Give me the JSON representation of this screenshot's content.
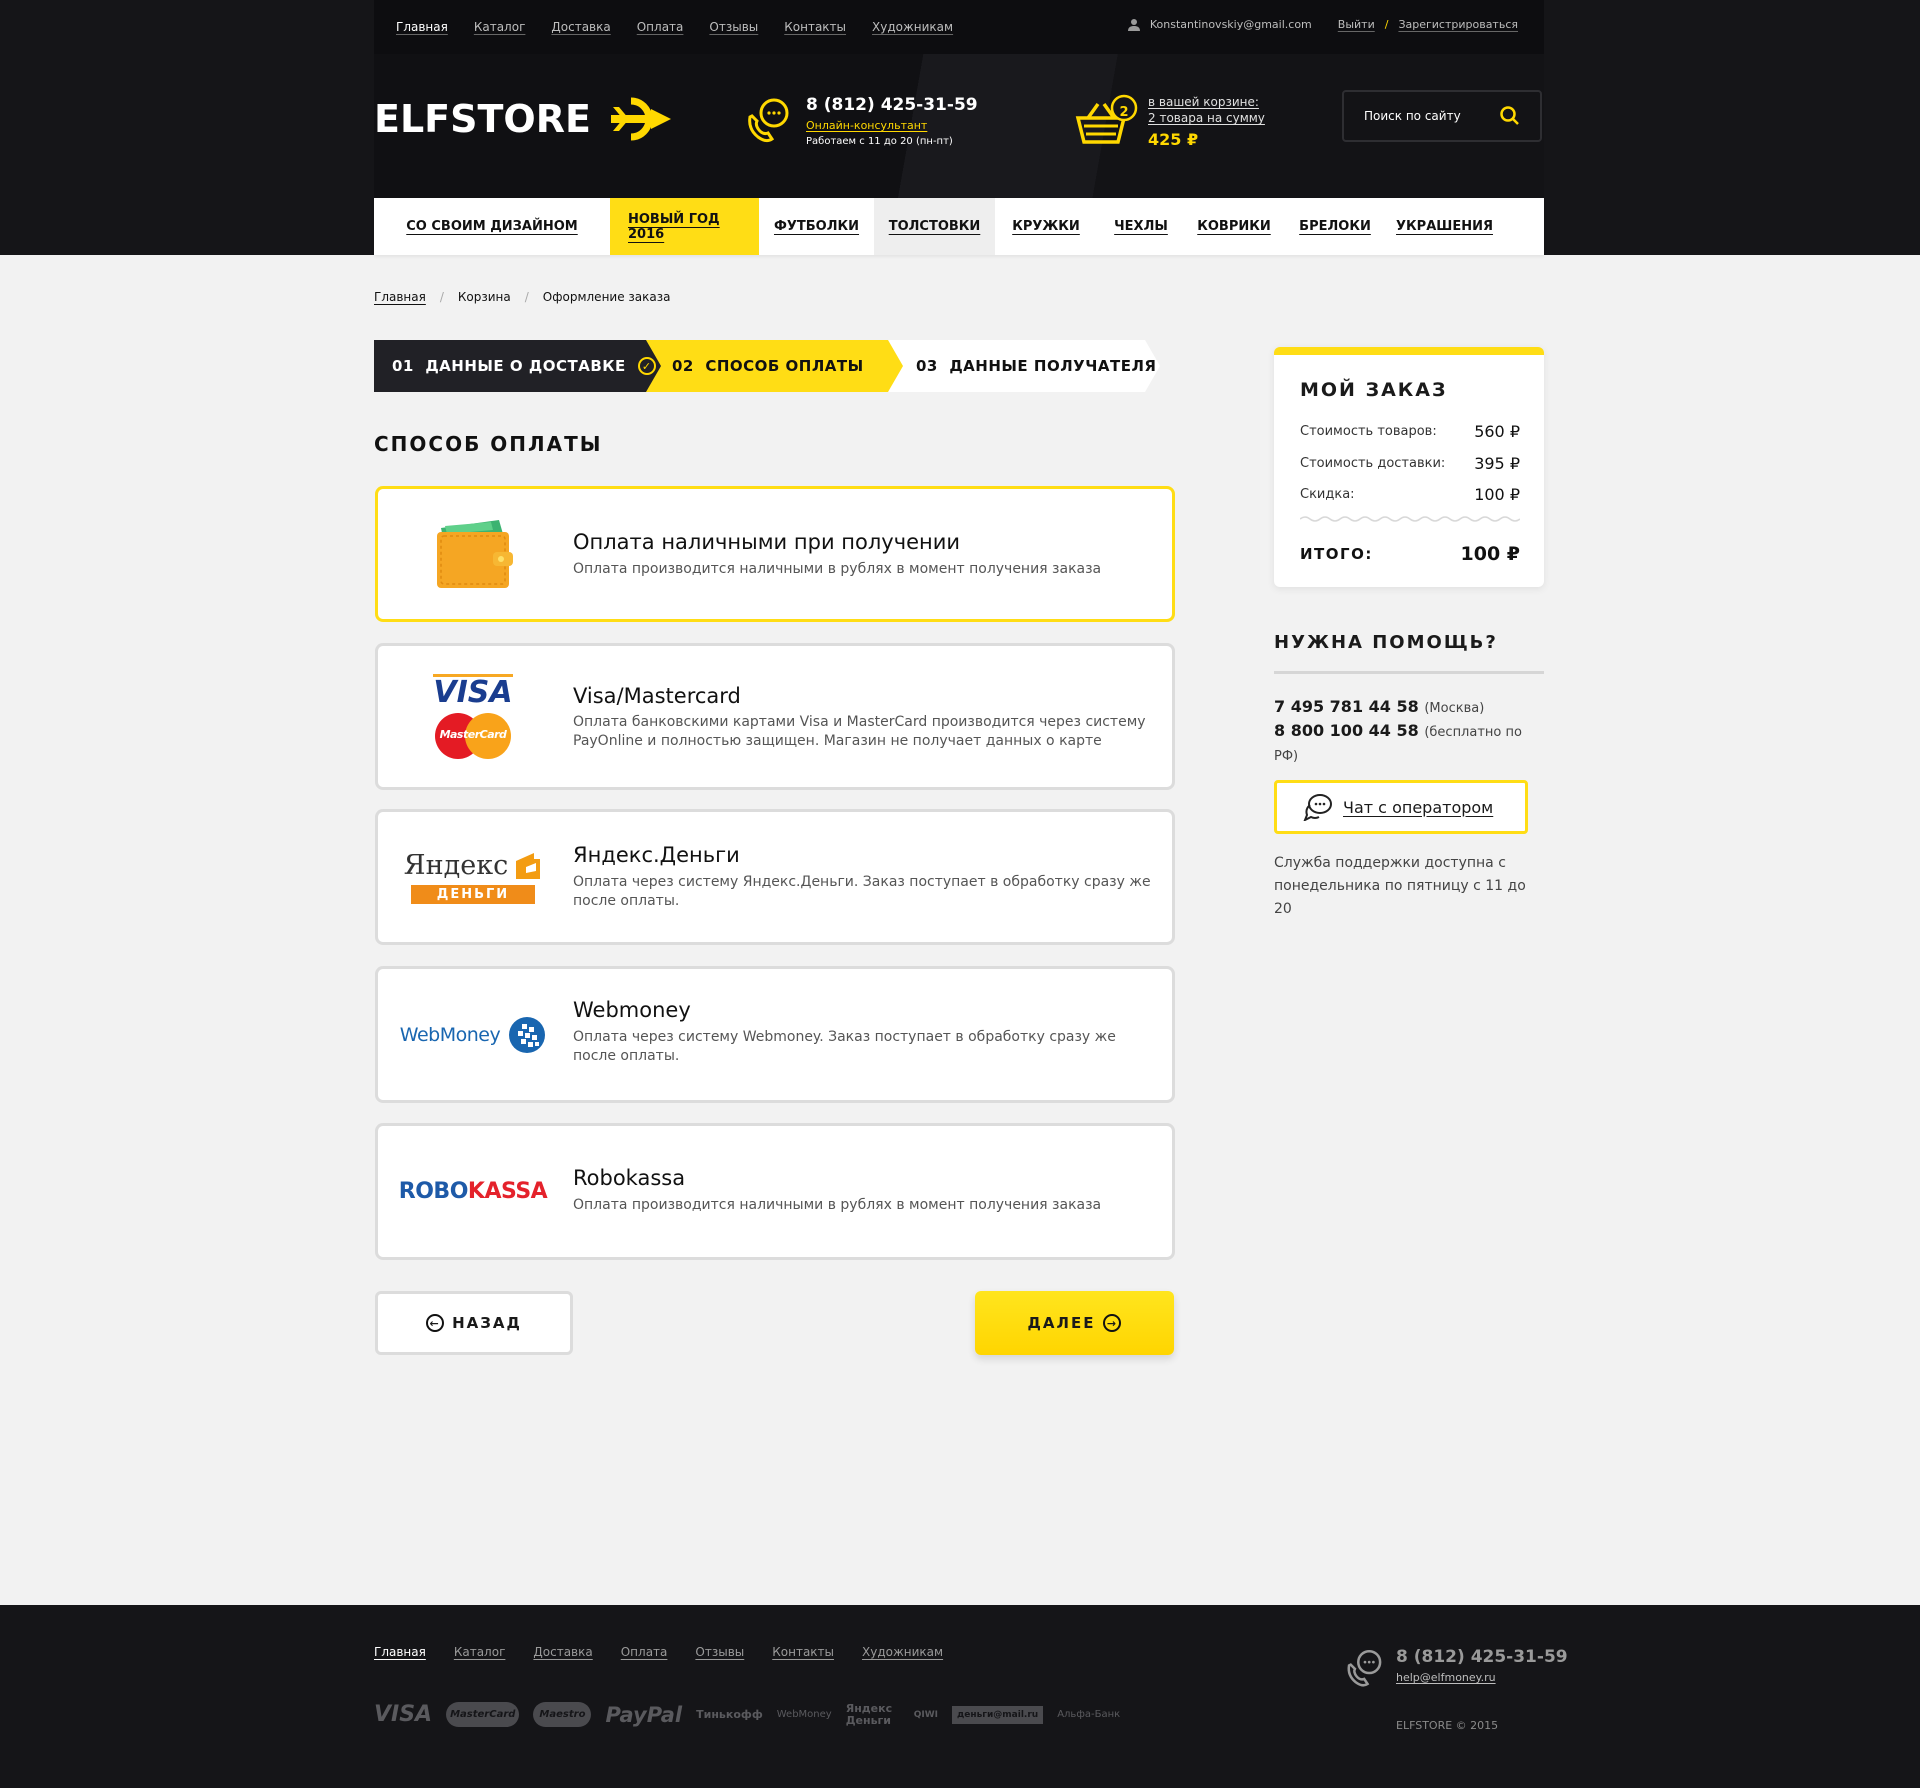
{
  "topbar": {
    "nav": [
      "Главная",
      "Каталог",
      "Доставка",
      "Оплата",
      "Отзывы",
      "Контакты",
      "Художникам"
    ],
    "user_email": "Konstantinovskiy@gmail.com",
    "logout": "Выйти",
    "register": "Зарегистрироваться"
  },
  "header": {
    "logo": "ELFSTORE",
    "phone": "8 (812) 425-31-59",
    "consultant": "Онлайн-консультант",
    "hours": "Работаем с 11 до 20 (пн-пт)",
    "cart_count": "2",
    "cart_line1": "в вашей корзине:",
    "cart_line2": "2 товара на сумму",
    "cart_sum": "425 ₽",
    "search_placeholder": "Поиск по сайту"
  },
  "catnav": [
    "СО СВОИМ ДИЗАЙНОМ",
    "НОВЫЙ ГОД 2016",
    "ФУТБОЛКИ",
    "ТОЛСТОВКИ",
    "КРУЖКИ",
    "ЧЕХЛЫ",
    "КОВРИКИ",
    "БРЕЛОКИ",
    "УКРАШЕНИЯ"
  ],
  "breadcrumbs": [
    "Главная",
    "Корзина",
    "Оформление заказа"
  ],
  "steps": [
    "01  ДАННЫЕ О ДОСТАВКЕ",
    "02  СПОСОБ ОПЛАТЫ",
    "03  ДАННЫЕ ПОЛУЧАТЕЛЯ"
  ],
  "payment_title": "СПОСОБ ОПЛАТЫ",
  "methods": [
    {
      "title": "Оплата наличными при получении",
      "desc": "Оплата производится наличными в рублях в момент получения заказа"
    },
    {
      "title": "Visa/Mastercard",
      "desc": "Оплата банковскими картами Visa и MasterCard производится через систему PayOnline и полностью защищен. Магазин не получает данных о карте"
    },
    {
      "title": "Яндекс.Деньги",
      "desc": "Оплата через систему Яндекс.Деньги. Заказ поступает в обработку сразу же после оплаты."
    },
    {
      "title": "Webmoney",
      "desc": "Оплата через систему Webmoney. Заказ поступает в обработку сразу же после оплаты."
    },
    {
      "title": "Robokassa",
      "desc": "Оплата производится наличными в рублях в момент получения заказа"
    }
  ],
  "method_logos": {
    "visa": "VISA",
    "mastercard": "MasterCard",
    "yandex": "Яндекс",
    "yandex_sub": "ДЕНЬГИ",
    "webmoney": "WebMoney",
    "robo": "ROBO",
    "kassa": "KASSA"
  },
  "buttons": {
    "back": "НАЗАД",
    "next": "ДАЛЕЕ"
  },
  "order": {
    "title": "МОЙ ЗАКАЗ",
    "goods_label": "Стоимость товаров:",
    "goods_value": "560 ₽",
    "delivery_label": "Стоимость доставки:",
    "delivery_value": "395 ₽",
    "discount_label": "Скидка:",
    "discount_value": "100 ₽",
    "total_label": "ИТОГО:",
    "total_value": "100 ₽"
  },
  "help": {
    "title": "НУЖНА ПОМОЩЬ?",
    "phone1": "7 495 781 44 58",
    "phone1_note": "(Москва)",
    "phone2": "8 800 100 44 58",
    "phone2_note": "(бесплатно по РФ)",
    "chat": "Чат с оператором",
    "note": "Служба поддержки доступна с понедельника по пятницу с 11 до 20"
  },
  "footer": {
    "nav": [
      "Главная",
      "Каталог",
      "Доставка",
      "Оплата",
      "Отзывы",
      "Контакты",
      "Художникам"
    ],
    "phone": "8 (812) 425-31-59",
    "email": "help@elfmoney.ru",
    "copyright": "ELFSTORE © 2015",
    "pay_logos": [
      "VISA",
      "MasterCard",
      "Maestro",
      "PayPal",
      "Тинькофф",
      "WebMoney",
      "Яндекс Деньги",
      "QIWI",
      "деньги@mail.ru",
      "Альфа-Банк"
    ]
  },
  "colors": {
    "accent": "#ffdd15",
    "dark": "#151518",
    "bg": "#f2f2f2"
  }
}
